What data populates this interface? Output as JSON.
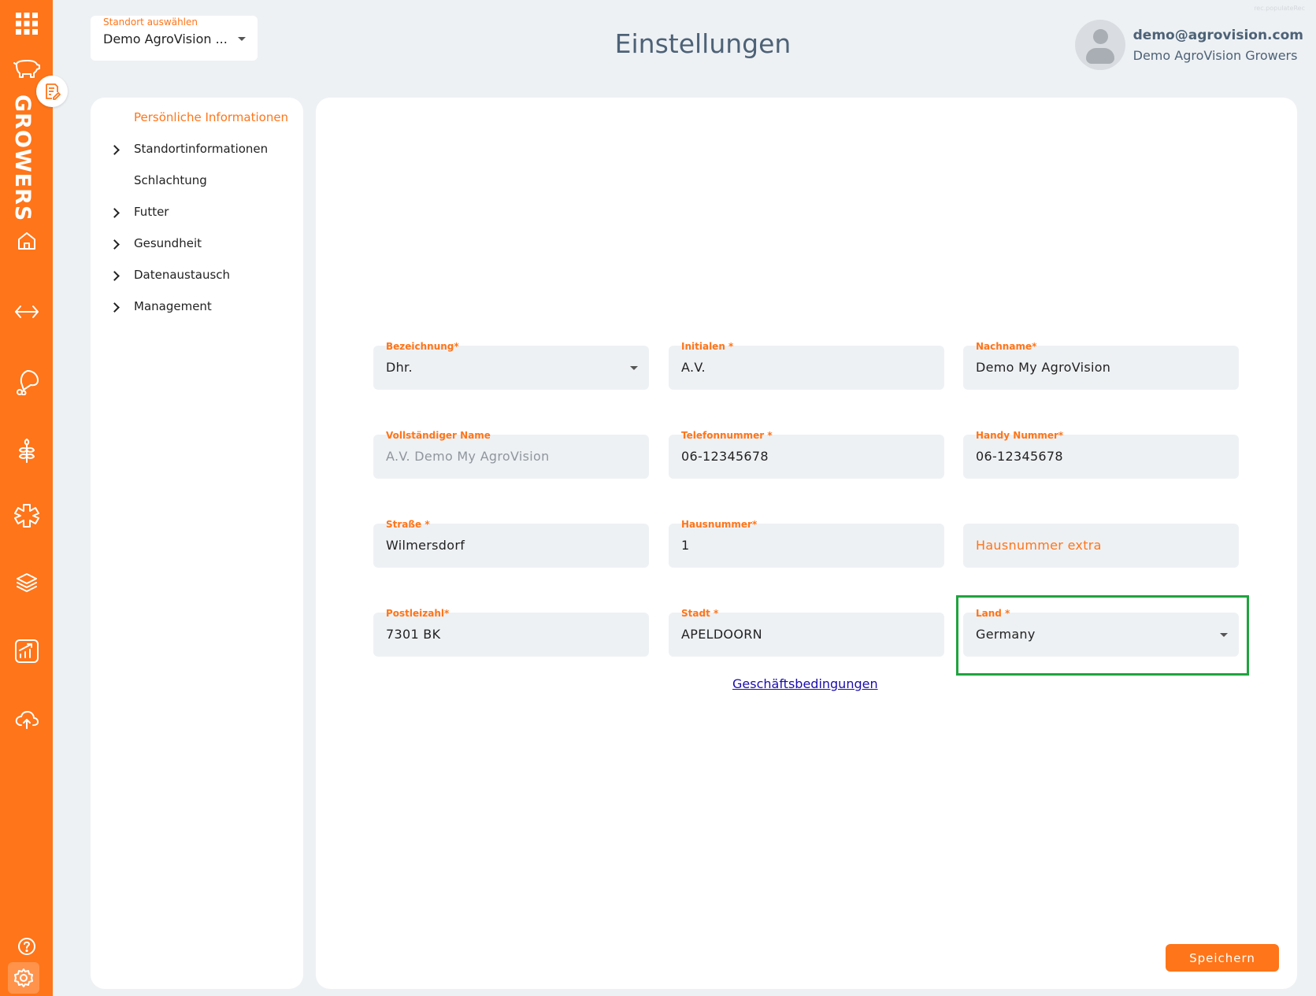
{
  "app": {
    "brand": "GROWERS",
    "page_title": "Einstellungen",
    "corner_note": "rec.populateRec"
  },
  "site_selector": {
    "label": "Standort auswählen",
    "value": "Demo AgroVision ..."
  },
  "user": {
    "email": "demo@agrovision.com",
    "organization": "Demo AgroVision Growers"
  },
  "rail_icons": [
    "apps-grid-icon",
    "pig-icon",
    "notes-icon",
    "home-icon",
    "transfer-icon",
    "ham-icon",
    "grain-icon",
    "health-icon",
    "layers-icon",
    "chart-icon",
    "cloud-upload-icon",
    "help-icon",
    "gear-icon"
  ],
  "subnav": {
    "items": [
      {
        "label": "Persönliche Informationen",
        "active": true,
        "expandable": false
      },
      {
        "label": "Standortinformationen",
        "active": false,
        "expandable": true
      },
      {
        "label": "Schlachtung",
        "active": false,
        "expandable": false
      },
      {
        "label": "Futter",
        "active": false,
        "expandable": true
      },
      {
        "label": "Gesundheit",
        "active": false,
        "expandable": true
      },
      {
        "label": "Datenaustausch",
        "active": false,
        "expandable": true
      },
      {
        "label": "Management",
        "active": false,
        "expandable": true
      }
    ]
  },
  "form": {
    "bezeichnung": {
      "label": "Bezeichnung*",
      "value": "Dhr."
    },
    "initialen": {
      "label": "Initialen *",
      "value": "A.V."
    },
    "nachname": {
      "label": "Nachname*",
      "value": "Demo My AgroVision"
    },
    "vollstaendiger_name": {
      "label": "Vollständiger Name",
      "value": "A.V. Demo My AgroVision"
    },
    "telefonnummer": {
      "label": "Telefonnummer *",
      "value": "06-12345678"
    },
    "handy_nummer": {
      "label": "Handy Nummer*",
      "value": "06-12345678"
    },
    "strasse": {
      "label": "Straße *",
      "value": "Wilmersdorf"
    },
    "hausnummer": {
      "label": "Hausnummer*",
      "value": "1"
    },
    "hausnummer_extra": {
      "placeholder": "Hausnummer extra"
    },
    "postleitzahl": {
      "label": "Postleizahl*",
      "value": "7301 BK"
    },
    "stadt": {
      "label": "Stadt *",
      "value": "APELDOORN"
    },
    "land": {
      "label": "Land *",
      "value": "Germany"
    }
  },
  "links": {
    "terms": "Geschäftsbedingungen"
  },
  "actions": {
    "save": "Speichern"
  },
  "colors": {
    "accent": "#ff7519",
    "highlight": "#1ea43e",
    "background": "#eef1f4"
  }
}
